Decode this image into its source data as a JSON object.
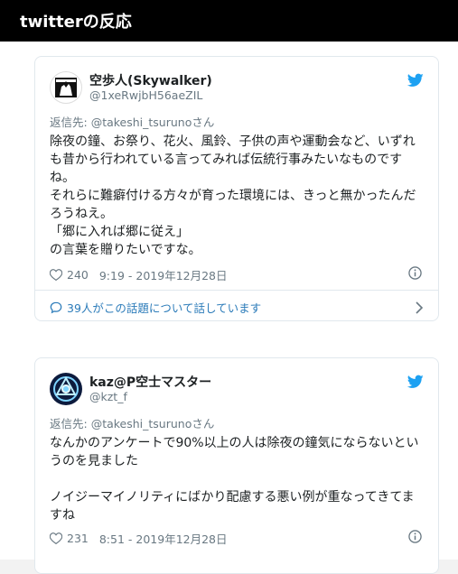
{
  "header": {
    "title": "twitterの反応"
  },
  "colors": {
    "accent": "#1da1f2",
    "link": "#2b7bb9",
    "muted": "#697882",
    "header_bg": "#000000"
  },
  "tweets": [
    {
      "name": "空歩人(Skywalker)",
      "handle": "@1xeRwjbH56aeZIL",
      "reply_label": "返信先: ",
      "reply_to": "@takeshi_tsurunoさん",
      "text": "除夜の鐘、お祭り、花火、風鈴、子供の声や運動会など、いずれも昔から行われている言ってみれば伝統行事みたいなものですね。\nそれらに難癖付ける方々が育った環境には、きっと無かったんだろうねえ。\n「郷に入れば郷に従え」\nの言葉を贈りたいですな。",
      "likes": "240",
      "time": "9:19 - 2019年12月28日",
      "conversation": "39人がこの話題について話しています",
      "avatar_icon": "silhouette-logo-icon"
    },
    {
      "name": "kaz@P空士マスター",
      "handle": "@kzt_f",
      "reply_label": "返信先: ",
      "reply_to": "@takeshi_tsurunoさん",
      "text": "なんかのアンケートで90%以上の人は除夜の鐘気にならないというのを見ました\n\nノイジーマイノリティにばかり配慮する悪い例が重なってきてますね",
      "likes": "231",
      "time": "8:51 - 2019年12月28日",
      "avatar_icon": "arc-reactor-icon"
    }
  ]
}
